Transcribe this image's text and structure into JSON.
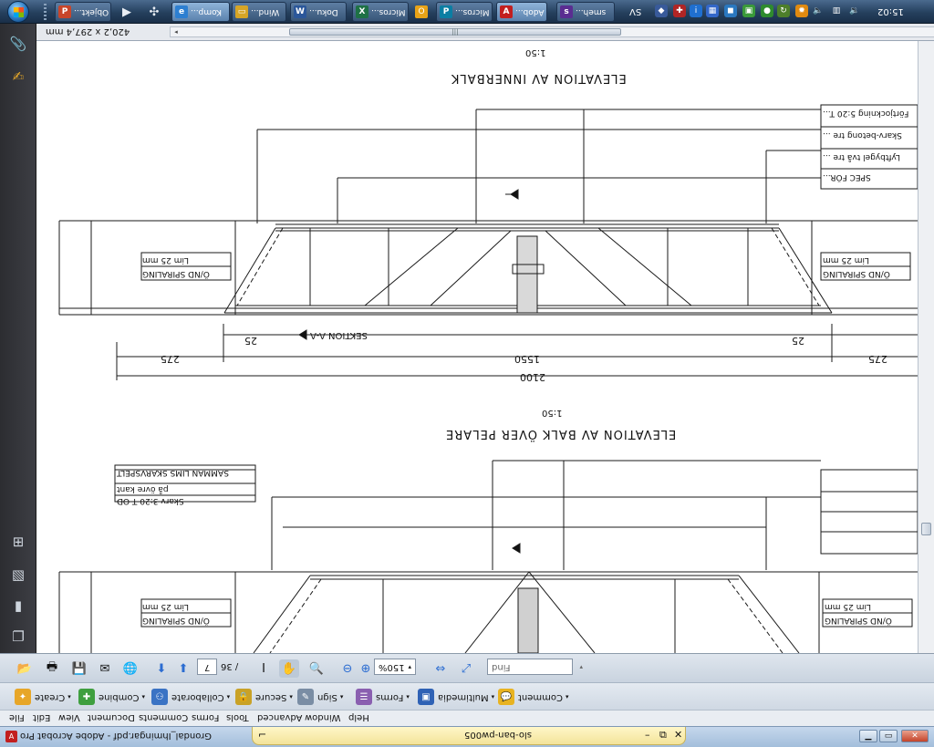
{
  "taskbar": {
    "buttons": [
      {
        "label": "Objekt...",
        "icon": "powerpoint-icon",
        "color": "#c8452a",
        "active": false
      },
      {
        "label": "Komp...",
        "icon": "ie-icon",
        "color": "#2d7fd1",
        "active": true
      },
      {
        "label": "Wind...",
        "icon": "folder-icon",
        "color": "#d6a526",
        "active": false
      },
      {
        "label": "Doku...",
        "icon": "word-icon",
        "color": "#2b579a",
        "active": false
      },
      {
        "label": "Micros...",
        "icon": "excel-icon",
        "color": "#1e7145",
        "active": false
      },
      {
        "label": "Micros...",
        "icon": "publisher-icon",
        "color": "#0b7ea3",
        "active": false
      },
      {
        "label": "Adob...",
        "icon": "acrobat-icon",
        "color": "#c21f1f",
        "active": true
      },
      {
        "label": "smeh...",
        "icon": "app-icon",
        "color": "#5a2d91",
        "active": false
      }
    ],
    "tray_language": "SV",
    "clock": "15:02"
  },
  "document": {
    "page_size": "420,2 x 297,4 mm",
    "drawing": {
      "top_title": "ELEVATION AV INNERBALK",
      "top_scale": "1:50",
      "top_total_dim": "2100",
      "top_mid_dim": "1550",
      "top_side_dims": [
        "275",
        "275"
      ],
      "top_small_dims": [
        "25",
        "25"
      ],
      "section_label": "SEKTION A-A",
      "bottom_title": "ELEVATION AV BALK ÖVER PELARE",
      "bottom_scale": "1:50",
      "notes_left": [
        "Lim 25 mm",
        "Ö/ND SPIRALING"
      ],
      "notes_right": [
        "Lim 25 mm",
        "Ö/ND SPIRALING"
      ],
      "notes_block_1": [
        "Förtjockning 5:20 T...",
        "Skarv-betong tre ...",
        "Lyftbygel två tre ...",
        "SPEC FÖR..."
      ],
      "notes_block_2": [
        "SAMMAN LIMS SKARVSPELT",
        "på övre kant",
        "Skarv 3:20 T OD"
      ]
    }
  },
  "toolbar": {
    "page_current": "7",
    "page_total": "/ 36",
    "zoom": "150%",
    "find_placeholder": "Find"
  },
  "tasks": [
    "Create",
    "Combine",
    "Collaborate",
    "Secure",
    "Sign",
    "Forms",
    "Multimedia",
    "Comment"
  ],
  "menu": [
    "File",
    "Edit",
    "View",
    "Document",
    "Comments",
    "Forms",
    "Tools",
    "Advanced",
    "Window",
    "Help"
  ],
  "window": {
    "title": "Grondal_Ihmingar.pdf - Adobe Acrobat Pro",
    "doc_tab": "slo-ban-pw005",
    "title_icon": "acrobat-icon"
  }
}
